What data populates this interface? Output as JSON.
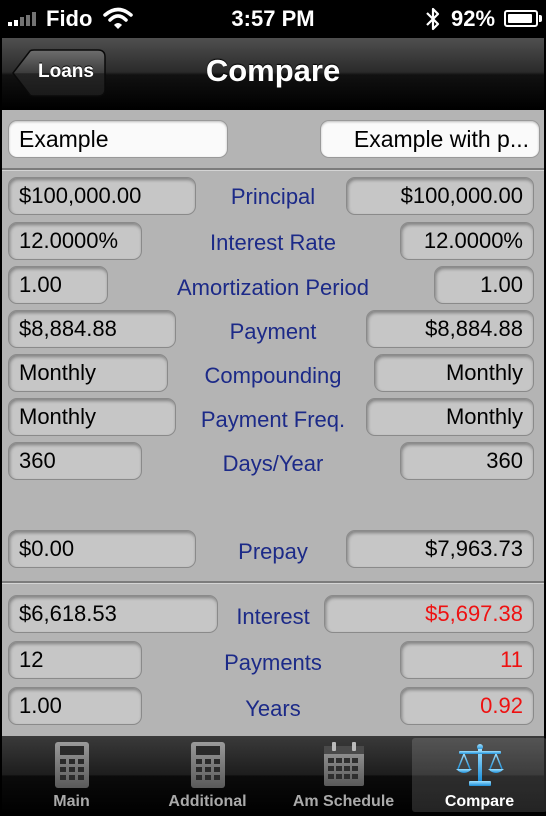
{
  "status_bar": {
    "carrier": "Fido",
    "time": "3:57 PM",
    "battery": "92%",
    "battery_level": 0.92
  },
  "nav": {
    "back_label": "Loans",
    "title": "Compare"
  },
  "loan_names": {
    "left": "Example",
    "right": "Example with p..."
  },
  "rows": [
    {
      "label": "Principal",
      "left": "$100,000.00",
      "right": "$100,000.00"
    },
    {
      "label": "Interest Rate",
      "left": "12.0000%",
      "right": "12.0000%"
    },
    {
      "label": "Amortization Period",
      "left": "1.00",
      "right": "1.00"
    },
    {
      "label": "Payment",
      "left": "$8,884.88",
      "right": "$8,884.88"
    },
    {
      "label": "Compounding",
      "left": "Monthly",
      "right": "Monthly"
    },
    {
      "label": "Payment Freq.",
      "left": "Monthly",
      "right": "Monthly"
    },
    {
      "label": "Days/Year",
      "left": "360",
      "right": "360"
    }
  ],
  "prepay": {
    "label": "Prepay",
    "left": "$0.00",
    "right": "$7,963.73"
  },
  "results": [
    {
      "label": "Interest",
      "left": "$6,618.53",
      "right": "$5,697.38"
    },
    {
      "label": "Payments",
      "left": "12",
      "right": "11"
    },
    {
      "label": "Years",
      "left": "1.00",
      "right": "0.92"
    }
  ],
  "colors": {
    "label": "#1c2a88",
    "difference": "#ee1111",
    "panel": "#b4b4b4"
  },
  "tabs": [
    {
      "label": "Main",
      "icon": "calculator-icon",
      "active": false
    },
    {
      "label": "Additional",
      "icon": "calculator-icon",
      "active": false
    },
    {
      "label": "Am Schedule",
      "icon": "calendar-icon",
      "active": false
    },
    {
      "label": "Compare",
      "icon": "scales-icon",
      "active": true
    }
  ]
}
